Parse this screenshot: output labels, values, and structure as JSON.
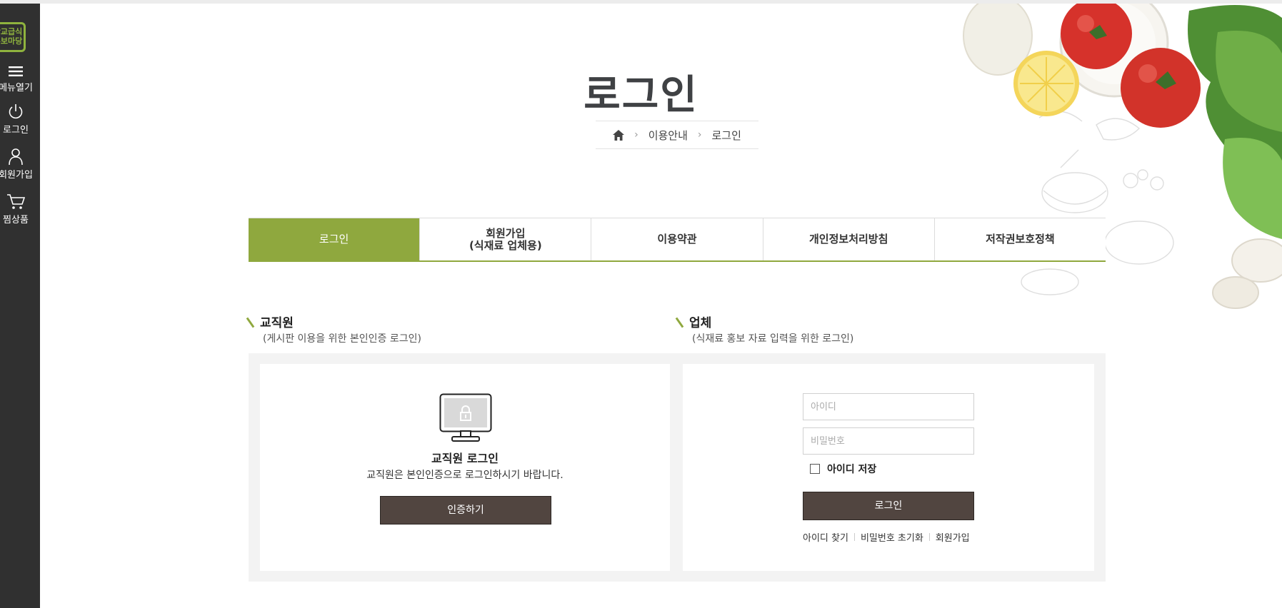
{
  "sidebar": {
    "logo_line1": "학교급식",
    "logo_line2": "홍보마당",
    "items": [
      {
        "label": "메뉴열기",
        "icon": "menu-icon"
      },
      {
        "label": "로그인",
        "icon": "power-icon"
      },
      {
        "label": "회원가입",
        "icon": "user-icon"
      },
      {
        "label": "찜상품",
        "icon": "cart-icon"
      }
    ]
  },
  "header": {
    "title": "로그인",
    "breadcrumb": [
      "이용안내",
      "로그인"
    ]
  },
  "tabs": [
    {
      "label": "로그인",
      "active": true
    },
    {
      "label": "회원가입\n(식재료 업체용)",
      "active": false
    },
    {
      "label": "이용약관",
      "active": false
    },
    {
      "label": "개인정보처리방침",
      "active": false
    },
    {
      "label": "저작권보호정책",
      "active": false
    }
  ],
  "staff": {
    "section_title": "교직원",
    "section_sub": "(게시판 이용을 위한 본인인증 로그인)",
    "title": "교직원 로그인",
    "desc": "교직원은 본인인증으로 로그인하시기 바랍니다.",
    "button": "인증하기"
  },
  "vendor": {
    "section_title": "업체",
    "section_sub": "(식재료 홍보 자료 입력을 위한 로그인)",
    "id_value": "",
    "id_placeholder": "아이디",
    "pw_value": "",
    "pw_placeholder": "비밀번호",
    "remember_label": "아이디 저장",
    "remember_checked": false,
    "button": "로그인",
    "links": [
      "아이디 찾기",
      "비밀번호 초기화",
      "회원가입"
    ]
  },
  "colors": {
    "accent": "#8fa83e",
    "sidebar_bg": "#303030",
    "button_bg": "#514540",
    "panel_bg": "#f3f3f3"
  }
}
